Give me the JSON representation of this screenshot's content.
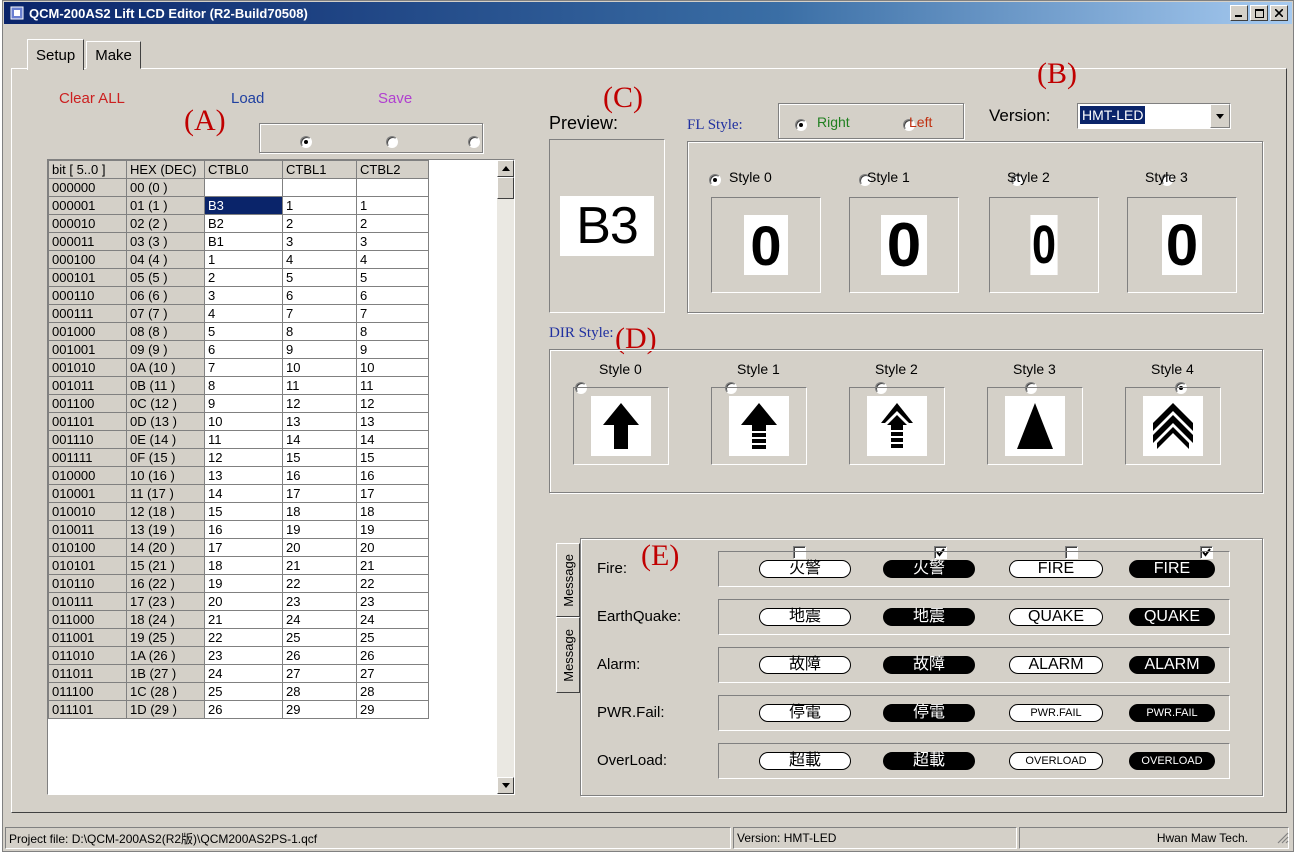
{
  "window": {
    "title": "QCM-200AS2 Lift LCD Editor (R2-Build70508)"
  },
  "tabs": [
    {
      "label": "Setup",
      "selected": true
    },
    {
      "label": "Make",
      "selected": false
    }
  ],
  "annotations": {
    "a": "(A)",
    "b": "(B)",
    "c": "(C)",
    "d": "(D)",
    "e": "(E)"
  },
  "toolbar": {
    "clear_all": "Clear ALL",
    "load": "Load",
    "save": "Save",
    "clear_color": "#cc2020",
    "load_color": "#2040a0",
    "save_color": "#b040d0"
  },
  "table_select": {
    "selected_index": 0
  },
  "table": {
    "headers": [
      "bit [ 5..0 ]",
      "HEX (DEC)",
      "CTBL0",
      "CTBL1",
      "CTBL2"
    ],
    "rows": [
      [
        "000000",
        "00 (0 )",
        "",
        "",
        ""
      ],
      [
        "000001",
        "01 (1 )",
        "B3",
        "1",
        "1"
      ],
      [
        "000010",
        "02 (2 )",
        "B2",
        "2",
        "2"
      ],
      [
        "000011",
        "03 (3 )",
        "B1",
        "3",
        "3"
      ],
      [
        "000100",
        "04 (4 )",
        "1",
        "4",
        "4"
      ],
      [
        "000101",
        "05 (5 )",
        "2",
        "5",
        "5"
      ],
      [
        "000110",
        "06 (6 )",
        "3",
        "6",
        "6"
      ],
      [
        "000111",
        "07 (7 )",
        "4",
        "7",
        "7"
      ],
      [
        "001000",
        "08 (8 )",
        "5",
        "8",
        "8"
      ],
      [
        "001001",
        "09 (9 )",
        "6",
        "9",
        "9"
      ],
      [
        "001010",
        "0A (10 )",
        "7",
        "10",
        "10"
      ],
      [
        "001011",
        "0B (11 )",
        "8",
        "11",
        "11"
      ],
      [
        "001100",
        "0C (12 )",
        "9",
        "12",
        "12"
      ],
      [
        "001101",
        "0D (13 )",
        "10",
        "13",
        "13"
      ],
      [
        "001110",
        "0E (14 )",
        "11",
        "14",
        "14"
      ],
      [
        "001111",
        "0F (15 )",
        "12",
        "15",
        "15"
      ],
      [
        "010000",
        "10 (16 )",
        "13",
        "16",
        "16"
      ],
      [
        "010001",
        "11 (17 )",
        "14",
        "17",
        "17"
      ],
      [
        "010010",
        "12 (18 )",
        "15",
        "18",
        "18"
      ],
      [
        "010011",
        "13 (19 )",
        "16",
        "19",
        "19"
      ],
      [
        "010100",
        "14 (20 )",
        "17",
        "20",
        "20"
      ],
      [
        "010101",
        "15 (21 )",
        "18",
        "21",
        "21"
      ],
      [
        "010110",
        "16 (22 )",
        "19",
        "22",
        "22"
      ],
      [
        "010111",
        "17 (23 )",
        "20",
        "23",
        "23"
      ],
      [
        "011000",
        "18 (24 )",
        "21",
        "24",
        "24"
      ],
      [
        "011001",
        "19 (25 )",
        "22",
        "25",
        "25"
      ],
      [
        "011010",
        "1A (26 )",
        "23",
        "26",
        "26"
      ],
      [
        "011011",
        "1B (27 )",
        "24",
        "27",
        "27"
      ],
      [
        "011100",
        "1C (28 )",
        "25",
        "28",
        "28"
      ],
      [
        "011101",
        "1D (29 )",
        "26",
        "29",
        "29"
      ]
    ],
    "selected_row": 1,
    "selected_col": 2
  },
  "preview": {
    "label": "Preview:",
    "value": "B3"
  },
  "fl_style": {
    "label": "FL Style:",
    "right": "Right",
    "left": "Left",
    "right_color": "#208020",
    "left_color": "#c03010",
    "label_color": "#2030a0",
    "selected": "right"
  },
  "version": {
    "label": "Version:",
    "value": "HMT-LED"
  },
  "fl_styles": [
    {
      "label": "Style 0",
      "digit": "0",
      "selected": true
    },
    {
      "label": "Style 1",
      "digit": "0",
      "selected": false
    },
    {
      "label": "Style 2",
      "digit": "0",
      "selected": false
    },
    {
      "label": "Style 3",
      "digit": "0",
      "selected": false
    }
  ],
  "dir_style": {
    "label": "DIR Style:",
    "label_color": "#2030a0"
  },
  "dir_styles": [
    {
      "label": "Style 0",
      "icon": "arrow-up-bold-icon",
      "selected": false
    },
    {
      "label": "Style 1",
      "icon": "arrow-up-striped-icon",
      "selected": false
    },
    {
      "label": "Style 2",
      "icon": "arrow-up-striped-narrow-icon",
      "selected": false
    },
    {
      "label": "Style 3",
      "icon": "triangle-up-icon",
      "selected": false
    },
    {
      "label": "Style 4",
      "icon": "double-chevron-up-icon",
      "selected": true
    }
  ],
  "message_checks": [
    false,
    true,
    false,
    true
  ],
  "message_tabs": [
    "Message",
    "Message"
  ],
  "messages": [
    {
      "label": "Fire:",
      "variants": [
        "火警",
        "火警",
        "FIRE",
        "FIRE"
      ],
      "small": false
    },
    {
      "label": "EarthQuake:",
      "variants": [
        "地震",
        "地震",
        "QUAKE",
        "QUAKE"
      ],
      "small": false
    },
    {
      "label": "Alarm:",
      "variants": [
        "故障",
        "故障",
        "ALARM",
        "ALARM"
      ],
      "small": false
    },
    {
      "label": "PWR.Fail:",
      "variants": [
        "停電",
        "停電",
        "PWR.FAIL",
        "PWR.FAIL"
      ],
      "small": true
    },
    {
      "label": "OverLoad:",
      "variants": [
        "超載",
        "超載",
        "OVERLOAD",
        "OVERLOAD"
      ],
      "small": true
    }
  ],
  "statusbar": {
    "project": "Project file: D:\\QCM-200AS2(R2版)\\QCM200AS2PS-1.qcf",
    "version": "Version: HMT-LED",
    "company": "Hwan Maw Tech."
  }
}
